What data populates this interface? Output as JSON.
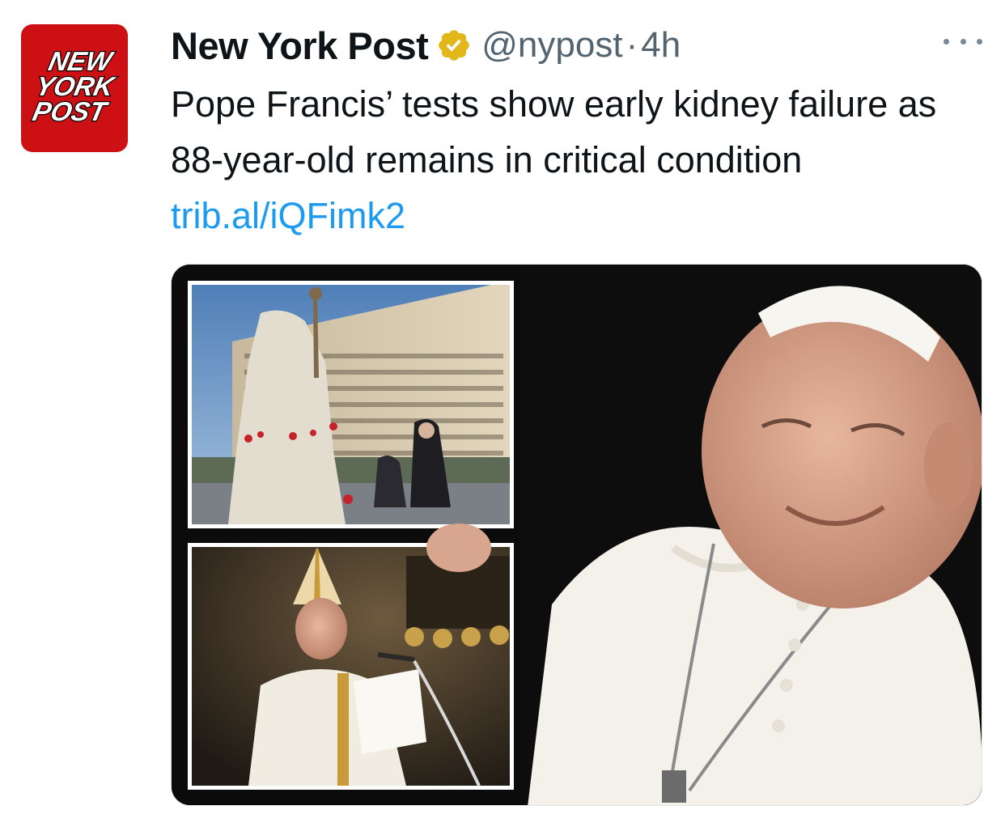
{
  "tweet": {
    "author": {
      "avatar_text_lines": [
        "NEW",
        "YORK",
        "POST"
      ],
      "avatar_color": "#cc1014",
      "display_name": "New York Post",
      "verified_badge_color": "#e2b719",
      "handle": "@nypost",
      "separator": "·",
      "timestamp": "4h"
    },
    "more_icon": "more-horizontal-icon",
    "text": "Pope Francis’ tests show early kidney failure as 88-year-old remains in critical condition ",
    "link_text": "trib.al/iQFimk2",
    "link_color": "#1d9bf0",
    "media": {
      "type": "photo-collage"
    }
  }
}
